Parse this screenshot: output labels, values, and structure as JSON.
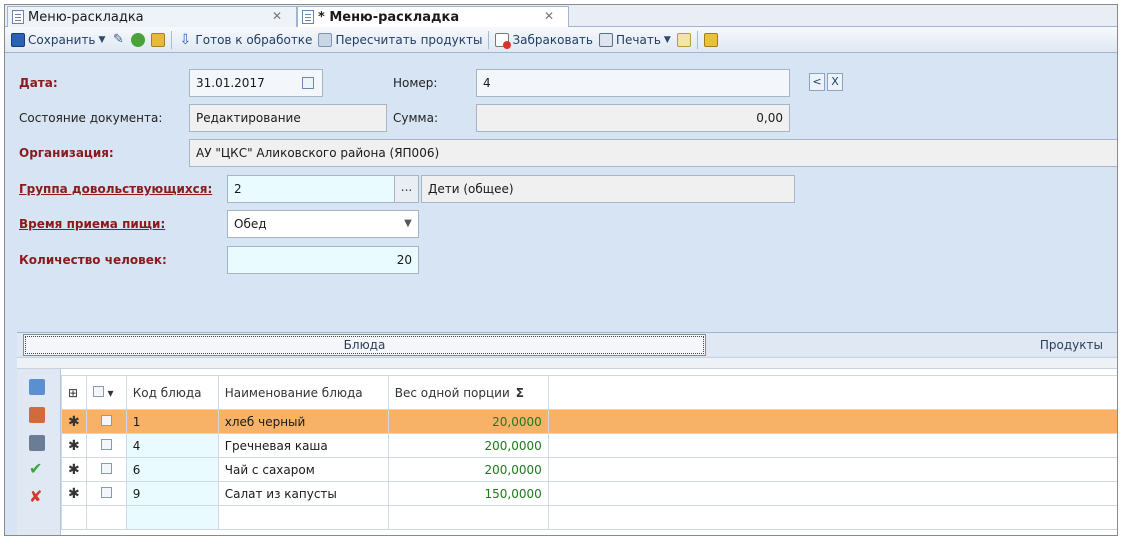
{
  "tabs": [
    {
      "label": "Меню-раскладка"
    },
    {
      "label": "* Меню-раскладка"
    }
  ],
  "toolbar": {
    "save": "Сохранить",
    "ready": "Готов к обработке",
    "recalc": "Пересчитать продукты",
    "reject": "Забраковать",
    "print": "Печать"
  },
  "form": {
    "date_label": "Дата:",
    "date_value": "31.01.2017",
    "number_label": "Номер:",
    "number_value": "4",
    "state_label": "Состояние документа:",
    "state_value": "Редактирование",
    "sum_label": "Сумма:",
    "sum_value": "0,00",
    "org_label": "Организация:",
    "org_value": "АУ \"ЦКС\" Аликовского района (ЯП006)",
    "group_label": "Группа довольствующихся:",
    "group_code": "2",
    "group_name": "Дети (общее)",
    "meal_label": "Время приема пищи:",
    "meal_value": "Обед",
    "count_label": "Количество человек:",
    "count_value": "20",
    "btn_prev": "<",
    "btn_clear": "X"
  },
  "section_tabs": {
    "active": "Блюда",
    "inactive": "Продукты"
  },
  "grid": {
    "col_code": "Код блюда",
    "col_name": "Наименование блюда",
    "col_weight": "Вес одной порции",
    "rows": [
      {
        "code": "1",
        "name": "хлеб черный",
        "weight": "20,0000"
      },
      {
        "code": "4",
        "name": "Гречневая каша",
        "weight": "200,0000"
      },
      {
        "code": "6",
        "name": "Чай с сахаром",
        "weight": "200,0000"
      },
      {
        "code": "9",
        "name": "Салат из капусты",
        "weight": "150,0000"
      }
    ]
  }
}
